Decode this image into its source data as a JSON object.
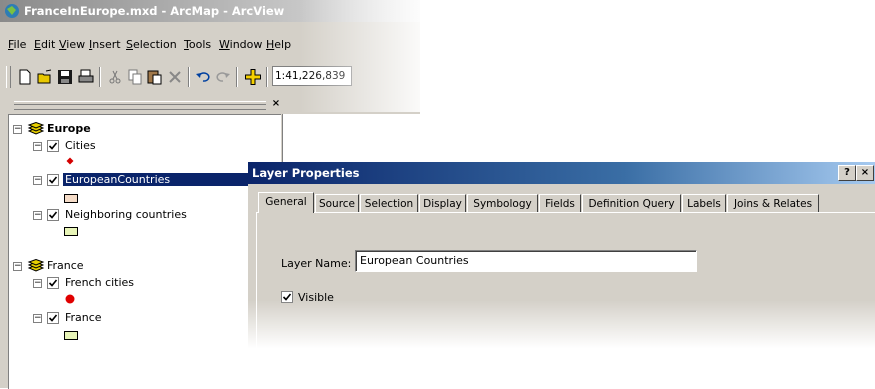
{
  "window": {
    "title": "FranceInEurope.mxd - ArcMap - ArcView"
  },
  "menu": [
    "File",
    "Edit",
    "View",
    "Insert",
    "Selection",
    "Tools",
    "Window",
    "Help"
  ],
  "toolbar": {
    "buttons": [
      "new-icon",
      "open-icon",
      "save-icon",
      "print-icon",
      "cut-icon",
      "copy-icon",
      "paste-icon",
      "delete-icon",
      "undo-icon",
      "redo-icon",
      "add-data-icon"
    ],
    "scale": "1:41,226,839"
  },
  "toc": {
    "groups": [
      {
        "name": "Europe",
        "layers": [
          {
            "name": "Cities",
            "checked": true,
            "symbol": "point",
            "color": "#d40000"
          },
          {
            "name": "EuropeanCountries",
            "checked": true,
            "selected": true,
            "symbol": "polygon",
            "color": "#f5dcc8"
          },
          {
            "name": "Neighboring countries",
            "checked": true,
            "symbol": "polygon",
            "color": "#e8f5b8"
          }
        ]
      },
      {
        "name": "France",
        "layers": [
          {
            "name": "French cities",
            "checked": true,
            "symbol": "point",
            "color": "#e00000"
          },
          {
            "name": "France",
            "checked": true,
            "symbol": "polygon",
            "color": "#e8f5b8"
          }
        ]
      }
    ]
  },
  "dialog": {
    "title": "Layer Properties",
    "help": "?",
    "close": "×",
    "tabs": [
      "General",
      "Source",
      "Selection",
      "Display",
      "Symbology",
      "Fields",
      "Definition Query",
      "Labels",
      "Joins & Relates"
    ],
    "active_tab": "General",
    "layer_name_label": "Layer Name:",
    "layer_name_value": "European Countries",
    "visible_label": "Visible",
    "visible": true
  },
  "colors": {
    "selection": "#0a246a",
    "dialog_title": "#0a246a",
    "folder_icon": "#e8d000"
  }
}
